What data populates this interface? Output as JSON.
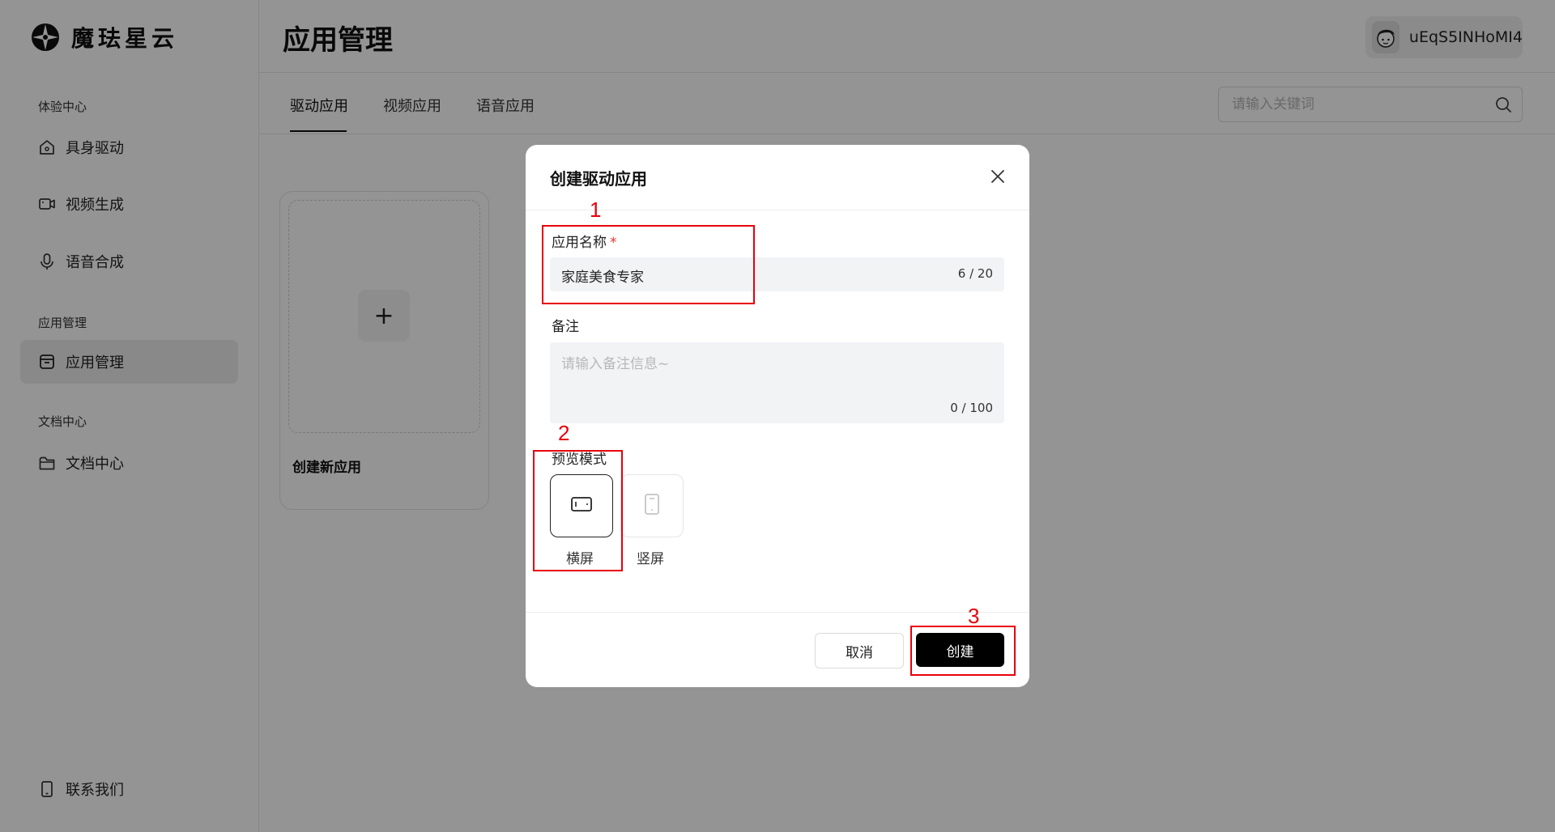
{
  "brand": {
    "name": "魔珐星云"
  },
  "sidebar": {
    "sections": [
      {
        "title": "体验中心"
      },
      {
        "title": "应用管理"
      },
      {
        "title": "文档中心"
      }
    ],
    "items": [
      {
        "label": "具身驱动",
        "icon": "home-icon"
      },
      {
        "label": "视频生成",
        "icon": "video-camera-icon"
      },
      {
        "label": "语音合成",
        "icon": "microphone-icon"
      },
      {
        "label": "应用管理",
        "icon": "app-box-icon",
        "active": true
      },
      {
        "label": "文档中心",
        "icon": "folder-icon"
      }
    ],
    "footer_item": {
      "label": "联系我们",
      "icon": "phone-icon"
    }
  },
  "header": {
    "title": "应用管理",
    "user": {
      "name": "uEqS5INHoMI4",
      "avatar_icon": "avatar-icon"
    }
  },
  "tabs": [
    {
      "label": "驱动应用",
      "active": true
    },
    {
      "label": "视频应用"
    },
    {
      "label": "语音应用"
    }
  ],
  "search": {
    "placeholder": "请输入关键词"
  },
  "create_card": {
    "label": "创建新应用",
    "icon": "plus-icon"
  },
  "modal": {
    "title": "创建驱动应用",
    "name_field": {
      "label": "应用名称",
      "required_mark": "*",
      "value": "家庭美食专家",
      "counter": "6 / 20"
    },
    "note_field": {
      "label": "备注",
      "placeholder": "请输入备注信息~",
      "counter": "0 / 100"
    },
    "preview_mode": {
      "label": "预览模式",
      "options": [
        {
          "label": "横屏",
          "icon": "landscape-device-icon",
          "selected": true
        },
        {
          "label": "竖屏",
          "icon": "portrait-device-icon",
          "selected": false
        }
      ]
    },
    "buttons": {
      "cancel": "取消",
      "create": "创建"
    }
  },
  "annotations": [
    {
      "number": "1",
      "color": "#e8000b"
    },
    {
      "number": "2",
      "color": "#e8000b"
    },
    {
      "number": "3",
      "color": "#e8000b"
    }
  ]
}
